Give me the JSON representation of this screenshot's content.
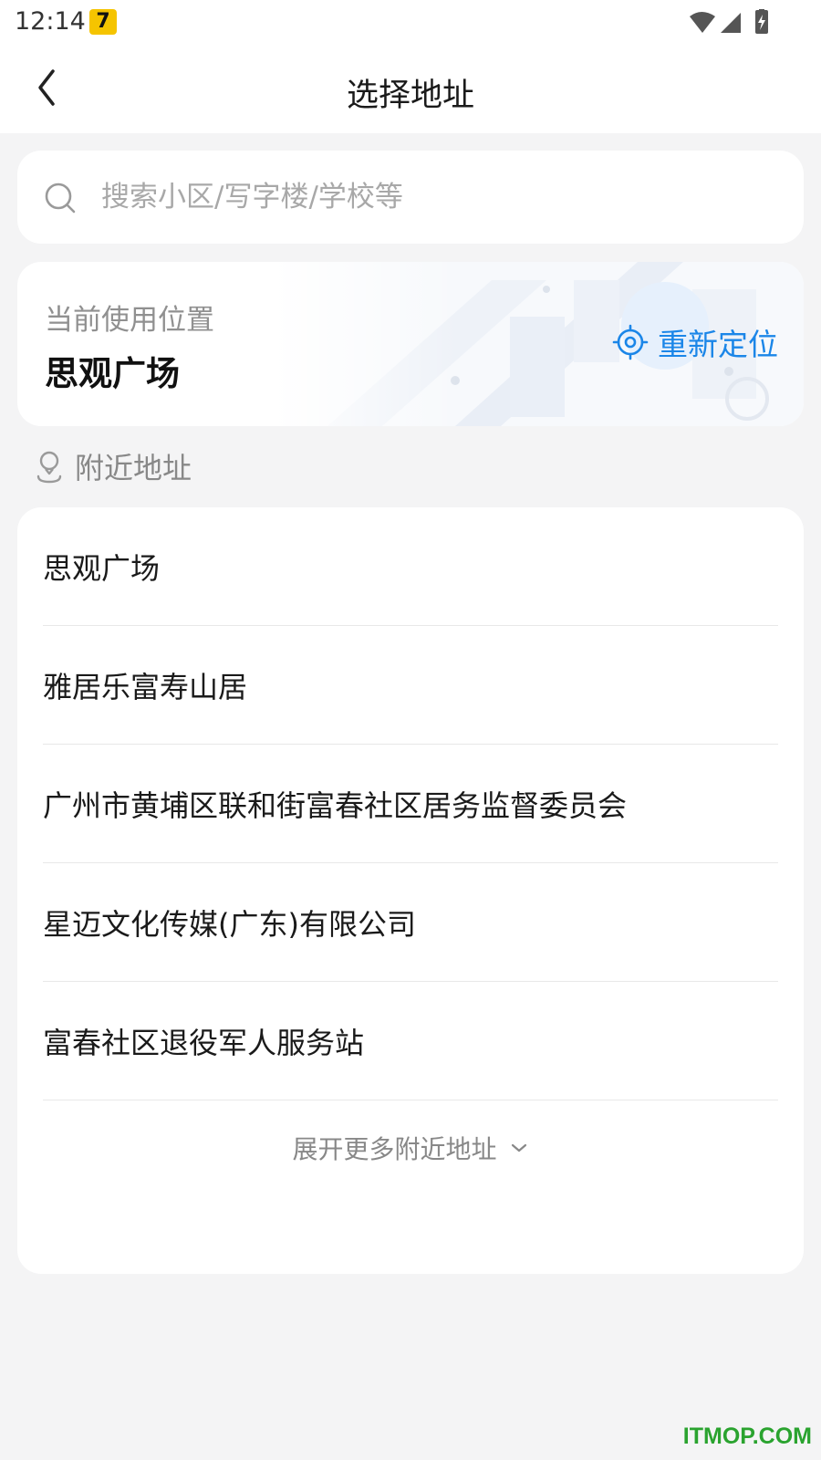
{
  "status_bar": {
    "time": "12:14",
    "app_badge": "7"
  },
  "header": {
    "title": "选择地址"
  },
  "search": {
    "placeholder": "搜索小区/写字楼/学校等"
  },
  "current_location": {
    "label": "当前使用位置",
    "name": "思观广场",
    "relocate_label": "重新定位"
  },
  "nearby": {
    "title": "附近地址",
    "items": [
      {
        "name": "思观广场"
      },
      {
        "name": "雅居乐富寿山居"
      },
      {
        "name": "广州市黄埔区联和街富春社区居务监督委员会"
      },
      {
        "name": "星迈文化传媒(广东)有限公司"
      },
      {
        "name": "富春社区退役军人服务站"
      }
    ],
    "expand_label": "展开更多附近地址"
  },
  "watermark": "ITMOP.COM",
  "colors": {
    "accent": "#1b86e8",
    "background": "#f4f4f5",
    "card": "#ffffff",
    "watermark": "#2aa32f"
  }
}
